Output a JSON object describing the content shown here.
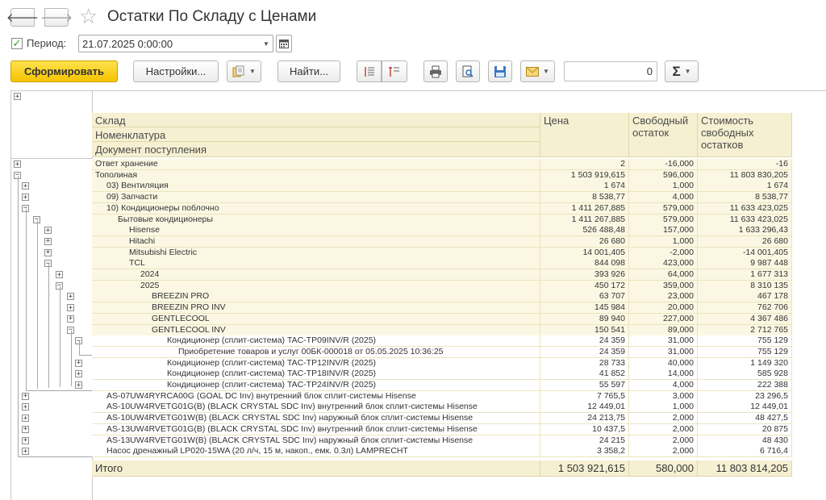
{
  "window": {
    "title": "Остатки По Складу с Ценами"
  },
  "period": {
    "label": "Период:",
    "value": "21.07.2025  0:00:00",
    "checked": true
  },
  "toolbar": {
    "generate_label": "Сформировать",
    "settings_label": "Настройки...",
    "find_label": "Найти...",
    "sum_value": "0",
    "sum_label": "Σ"
  },
  "table": {
    "headers": {
      "group1": "Склад",
      "group2": "Номенклатура",
      "group3": "Документ поступления",
      "price": "Цена",
      "free": "Свободный остаток",
      "cost": "Стоимость свободных остатков"
    },
    "rows": [
      {
        "name": "Ответ хранение",
        "level": 0,
        "price": "2",
        "free": "-16,000",
        "cost": "-16",
        "expander": "+"
      },
      {
        "name": "Тополиная",
        "level": 0,
        "price": "1 503 919,615",
        "free": "596,000",
        "cost": "11 803 830,205",
        "expander": "−"
      },
      {
        "name": "03) Вентиляция",
        "level": 1,
        "price": "1 674",
        "free": "1,000",
        "cost": "1 674",
        "expander": "+"
      },
      {
        "name": "09) Запчасти",
        "level": 1,
        "price": "8 538,77",
        "free": "4,000",
        "cost": "8 538,77",
        "expander": "+"
      },
      {
        "name": "10) Кондиционеры поблочно",
        "level": 1,
        "price": "1 411 267,885",
        "free": "579,000",
        "cost": "11 633 423,025",
        "expander": "−"
      },
      {
        "name": "Бытовые кондиционеры",
        "level": 2,
        "price": "1 411 267,885",
        "free": "579,000",
        "cost": "11 633 423,025",
        "expander": "−"
      },
      {
        "name": "Hisense",
        "level": 3,
        "price": "526 488,48",
        "free": "157,000",
        "cost": "1 633 296,43",
        "expander": "+"
      },
      {
        "name": "Hitachi",
        "level": 3,
        "price": "26 680",
        "free": "1,000",
        "cost": "26 680",
        "expander": "+"
      },
      {
        "name": "Mitsubishi Electric",
        "level": 3,
        "price": "14 001,405",
        "free": "-2,000",
        "cost": "-14 001,405",
        "expander": "+"
      },
      {
        "name": "TCL",
        "level": 3,
        "price": "844 098",
        "free": "423,000",
        "cost": "9 987 448",
        "expander": "−"
      },
      {
        "name": "2024",
        "level": 4,
        "price": "393 926",
        "free": "64,000",
        "cost": "1 677 313",
        "expander": "+"
      },
      {
        "name": "2025",
        "level": 4,
        "price": "450 172",
        "free": "359,000",
        "cost": "8 310 135",
        "expander": "−"
      },
      {
        "name": "BREEZIN PRO",
        "level": 5,
        "price": "63 707",
        "free": "23,000",
        "cost": "467 178",
        "expander": "+"
      },
      {
        "name": "BREEZIN PRO INV",
        "level": 5,
        "price": "145 984",
        "free": "20,000",
        "cost": "762 706",
        "expander": "+"
      },
      {
        "name": "GENTLECOOL",
        "level": 5,
        "price": "89 940",
        "free": "227,000",
        "cost": "4 367 486",
        "expander": "+"
      },
      {
        "name": "GENTLECOOL INV",
        "level": 5,
        "price": "150 541",
        "free": "89,000",
        "cost": "2 712 765",
        "expander": "−"
      },
      {
        "name": "Кондиционер (сплит-система) TAC-TP09INV/R (2025)",
        "level": 6,
        "price": "24 359",
        "free": "31,000",
        "cost": "755 129",
        "expander": "−"
      },
      {
        "name": "Приобретение товаров и услуг 00БК-000018 от 05.05.2025 10:36:25",
        "level": 7,
        "price": "24 359",
        "free": "31,000",
        "cost": "755 129",
        "expander": ""
      },
      {
        "name": "Кондиционер (сплит-система) TAC-TP12INV/R (2025)",
        "level": 6,
        "price": "28 733",
        "free": "40,000",
        "cost": "1 149 320",
        "expander": "+"
      },
      {
        "name": "Кондиционер (сплит-система) TAC-TP18INV/R (2025)",
        "level": 6,
        "price": "41 852",
        "free": "14,000",
        "cost": "585 928",
        "expander": "+"
      },
      {
        "name": "Кондиционер (сплит-система) TAC-TP24INV/R (2025)",
        "level": 6,
        "price": "55 597",
        "free": "4,000",
        "cost": "222 388",
        "expander": "+"
      },
      {
        "name": "AS-07UW4RYRCA00G (GOAL DC Inv) внутренний блок сплит-системы Hisense",
        "level": 1,
        "price": "7 765,5",
        "free": "3,000",
        "cost": "23 296,5",
        "expander": "+"
      },
      {
        "name": "AS-10UW4RVETG01G(B) (BLACK CRYSTAL SDC Inv) внутренний блок сплит-системы Hisense",
        "level": 1,
        "price": "12 449,01",
        "free": "1,000",
        "cost": "12 449,01",
        "expander": "+"
      },
      {
        "name": "AS-10UW4RVETG01W(B) (BLACK CRYSTAL SDC Inv) наружный блок сплит-системы Hisense",
        "level": 1,
        "price": "24 213,75",
        "free": "2,000",
        "cost": "48 427,5",
        "expander": "+"
      },
      {
        "name": "AS-13UW4RVETG01G(B) (BLACK CRYSTAL SDC Inv) внутренний блок сплит-системы Hisense",
        "level": 1,
        "price": "10 437,5",
        "free": "2,000",
        "cost": "20 875",
        "expander": "+"
      },
      {
        "name": "AS-13UW4RVETG01W(B) (BLACK CRYSTAL SDC Inv) наружный блок сплит-системы Hisense",
        "level": 1,
        "price": "24 215",
        "free": "2,000",
        "cost": "48 430",
        "expander": "+"
      },
      {
        "name": "Насос дренажный LP020-15WA (20 л/ч, 15 м, накоп., емк. 0.3л) LAMPRECHT",
        "level": 1,
        "price": "3 358,2",
        "free": "2,000",
        "cost": "6 716,4",
        "expander": "+"
      }
    ],
    "total": {
      "label": "Итого",
      "price": "1 503 921,615",
      "free": "580,000",
      "cost": "11 803 814,205"
    }
  }
}
